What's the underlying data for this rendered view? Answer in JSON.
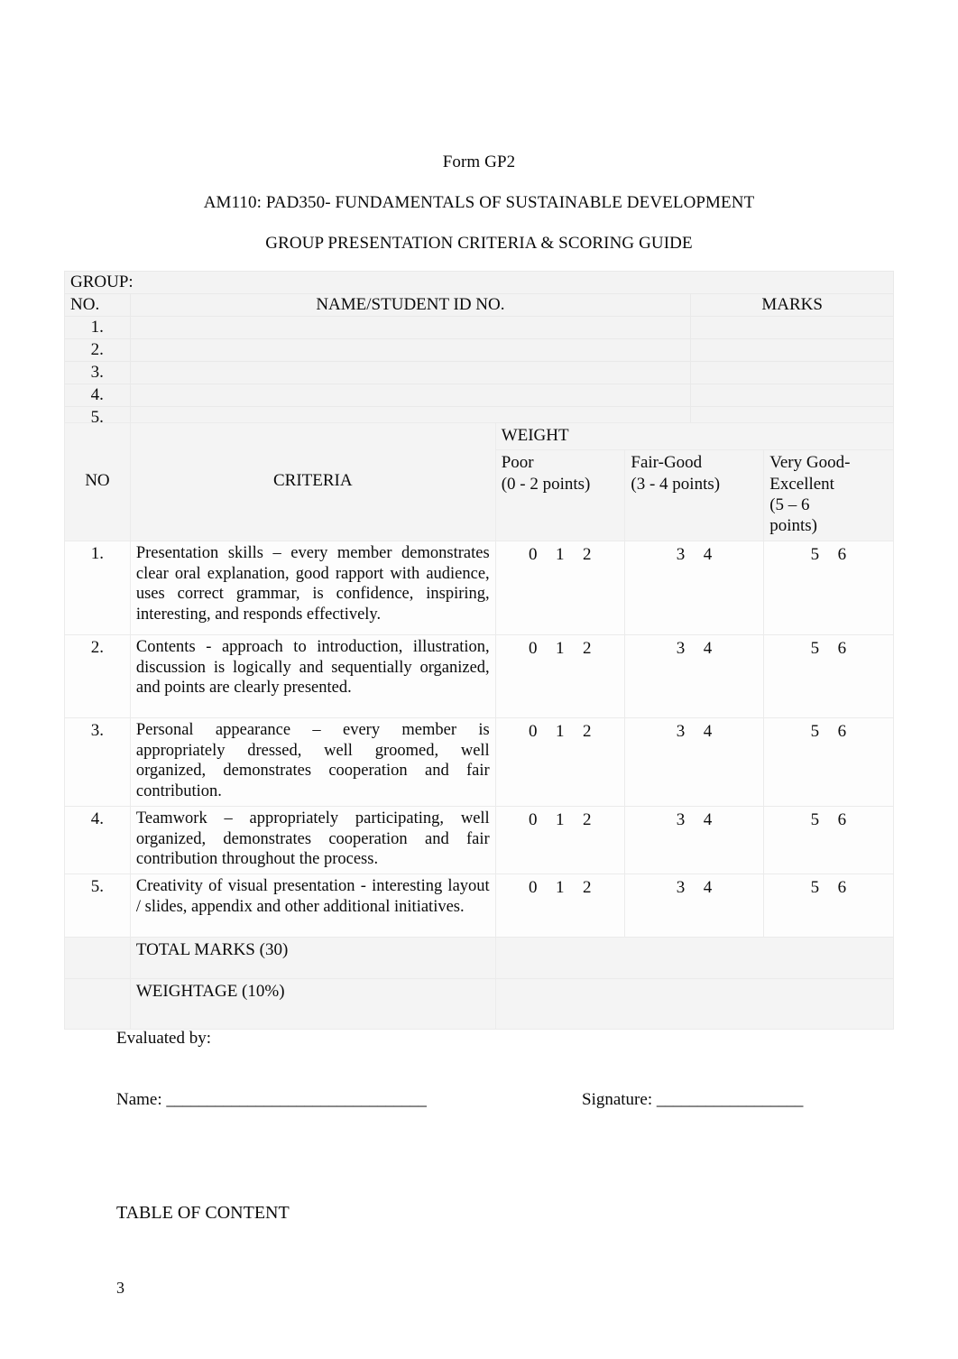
{
  "document": {
    "form_code": "Form GP2",
    "course_title": "AM110: PAD350- FUNDAMENTALS OF SUSTAINABLE DEVELOPMENT",
    "guide_title": "GROUP PRESENTATION CRITERIA & SCORING GUIDE",
    "page_number": "3",
    "toc_title": "TABLE OF CONTENT"
  },
  "roster": {
    "group_label": "GROUP:",
    "headers": {
      "no": "NO.",
      "name": "NAME/STUDENT ID NO.",
      "marks": "MARKS"
    },
    "rows": [
      {
        "no": "1.",
        "name": "",
        "marks": ""
      },
      {
        "no": "2.",
        "name": "",
        "marks": ""
      },
      {
        "no": "3.",
        "name": "",
        "marks": ""
      },
      {
        "no": "4.",
        "name": "",
        "marks": ""
      },
      {
        "no": "5.",
        "name": "",
        "marks": ""
      }
    ]
  },
  "rubric": {
    "headers": {
      "no": "NO",
      "criteria": "CRITERIA",
      "weight": "WEIGHT",
      "poor_label": "Poor",
      "poor_points": "(0 - 2 points)",
      "fair_label": "Fair-Good",
      "fair_points": "(3 - 4 points)",
      "vg_label": "Very Good-",
      "vg_label2": "Excellent",
      "vg_points": "(5 – 6",
      "vg_points2": "points)"
    },
    "rows": [
      {
        "no": "1.",
        "criteria": "Presentation skills –    every member demonstrates clear oral explanation, good rapport with audience, uses correct grammar, is confidence, inspiring, interesting, and responds effectively.",
        "poor": [
          "0",
          "1",
          "2"
        ],
        "fair": [
          "3",
          "4"
        ],
        "very_good": [
          "5",
          "6"
        ]
      },
      {
        "no": "2.",
        "criteria": "Contents -    approach to introduction, illustration, discussion is logically and sequentially organized, and points are clearly presented.",
        "poor": [
          "0",
          "1",
          "2"
        ],
        "fair": [
          "3",
          "4"
        ],
        "very_good": [
          "5",
          "6"
        ]
      },
      {
        "no": "3.",
        "criteria": "Personal appearance –    every member is appropriately dressed, well groomed, well organized, demonstrates cooperation and fair contribution.",
        "poor": [
          "0",
          "1",
          "2"
        ],
        "fair": [
          "3",
          "4"
        ],
        "very_good": [
          "5",
          "6"
        ]
      },
      {
        "no": "4.",
        "criteria": "Teamwork –  appropriately participating, well organized, demonstrates cooperation and fair contribution throughout the process.",
        "poor": [
          "0",
          "1",
          "2"
        ],
        "fair": [
          "3",
          "4"
        ],
        "very_good": [
          "5",
          "6"
        ]
      },
      {
        "no": "5.",
        "criteria": "Creativity of visual presentation - interesting layout / slides, appendix and other additional initiatives.",
        "poor": [
          "0",
          "1",
          "2"
        ],
        "fair": [
          "3",
          "4"
        ],
        "very_good": [
          "5",
          "6"
        ]
      }
    ],
    "total_marks_label": "TOTAL MARKS (30)",
    "weightage_label": "WEIGHTAGE (10%)"
  },
  "footer": {
    "evaluated_by": "Evaluated by:",
    "name_label": "Name:",
    "name_rule": "________________________________",
    "signature_label": "Signature:",
    "signature_rule": "__________________"
  }
}
